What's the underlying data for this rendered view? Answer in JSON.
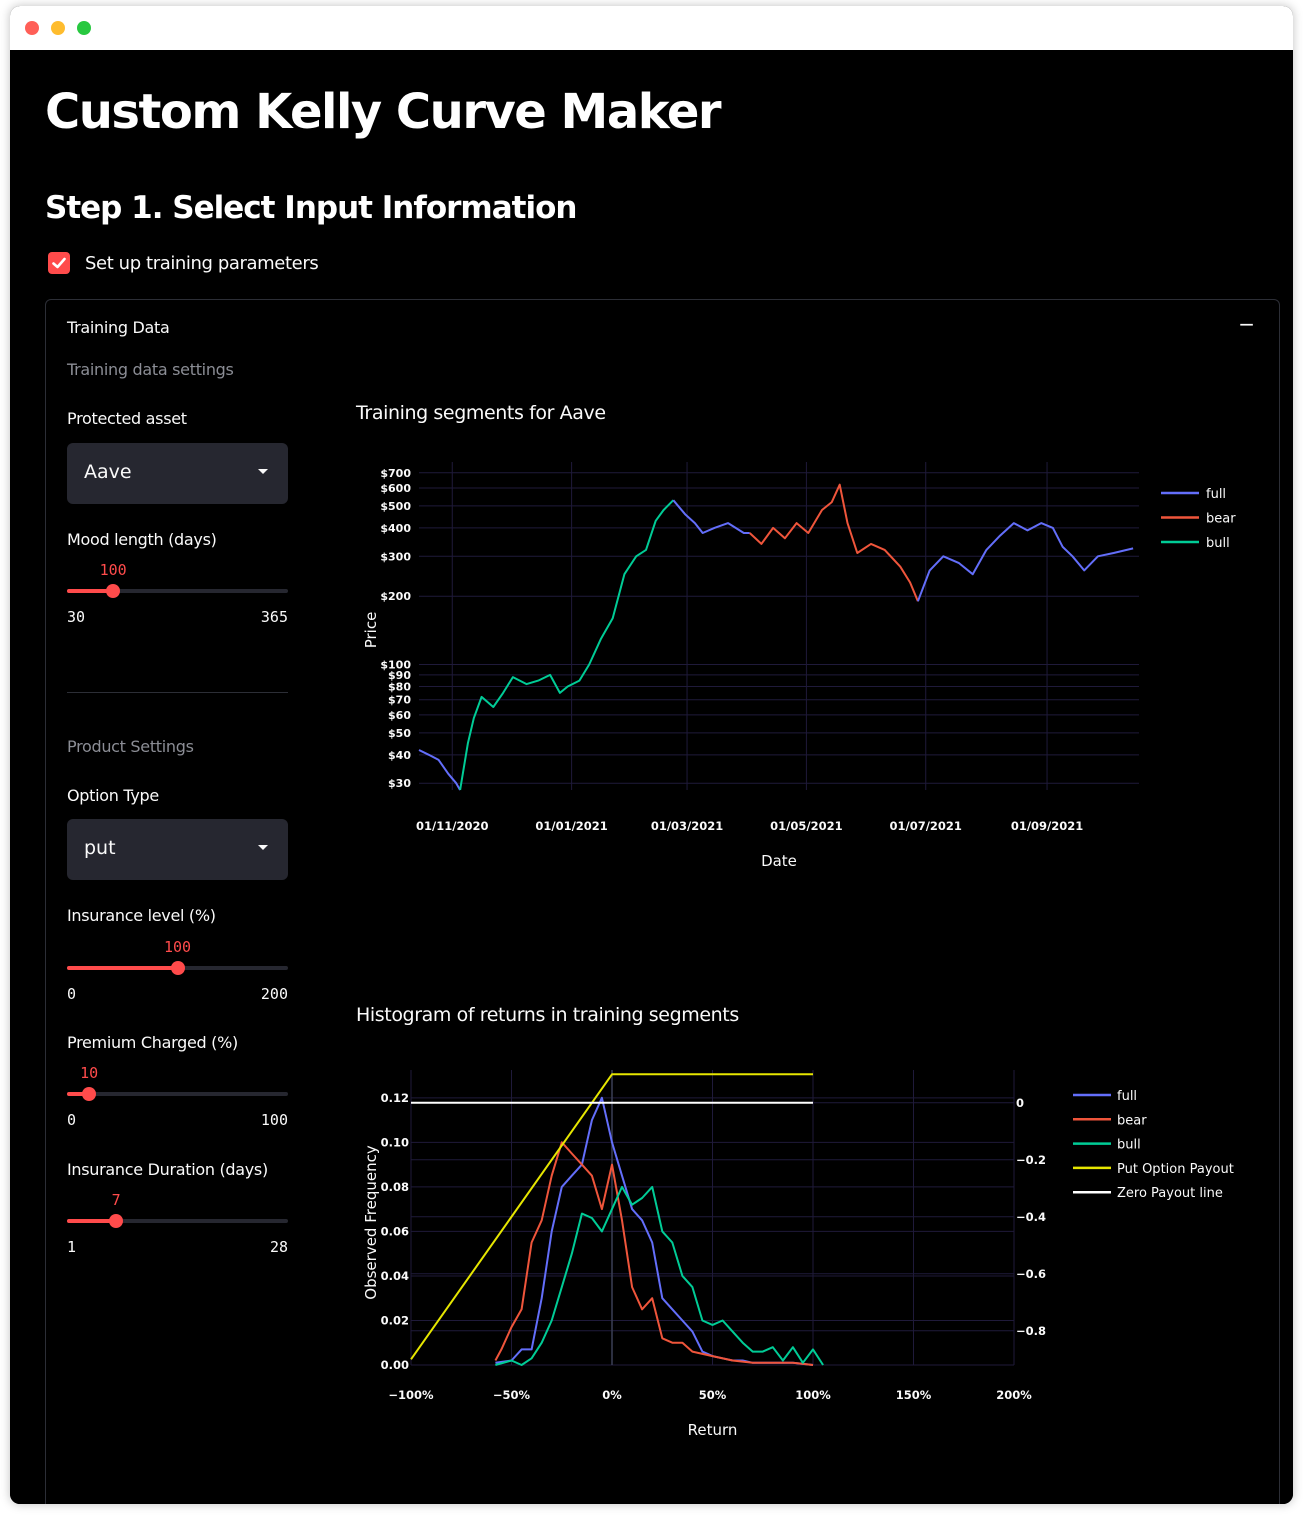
{
  "page": {
    "title": "Custom Kelly Curve Maker",
    "step_heading": "Step 1. Select Input Information",
    "checkbox_label": "Set up training parameters",
    "checkbox_checked": true
  },
  "expander": {
    "title": "Training Data",
    "collapse_icon": "minus-icon"
  },
  "sidebar": {
    "training_header": "Training data settings",
    "protected_asset_label": "Protected asset",
    "protected_asset_value": "Aave",
    "mood_length": {
      "label": "Mood length (days)",
      "value": 100,
      "min": 30,
      "max": 365,
      "value_text": "100",
      "min_text": "30",
      "max_text": "365"
    },
    "product_header": "Product Settings",
    "option_type_label": "Option Type",
    "option_type_value": "put",
    "insurance_level": {
      "label": "Insurance level (%)",
      "value": 100,
      "min": 0,
      "max": 200,
      "value_text": "100",
      "min_text": "0",
      "max_text": "200"
    },
    "premium": {
      "label": "Premium Charged (%)",
      "value": 10,
      "min": 0,
      "max": 100,
      "value_text": "10",
      "min_text": "0",
      "max_text": "100"
    },
    "duration": {
      "label": "Insurance Duration (days)",
      "value": 7,
      "min": 1,
      "max": 28,
      "value_text": "7",
      "min_text": "1",
      "max_text": "28"
    }
  },
  "colors": {
    "full": "#636efa",
    "bear": "#ef553b",
    "bull": "#00cc96",
    "payout": "#e6e600",
    "zero": "#ffffff",
    "accent": "#ff4b4b"
  },
  "chart_data": [
    {
      "type": "line",
      "title": "Training segments for Aave",
      "xlabel": "Date",
      "ylabel": "Price",
      "y_scale": "log",
      "y_ticks": [
        "$30",
        "$40",
        "$50",
        "$60",
        "$70",
        "$80",
        "$90",
        "$100",
        "$200",
        "$300",
        "$400",
        "$500",
        "$600",
        "$700"
      ],
      "x_ticks": [
        "01/11/2020",
        "01/01/2021",
        "01/03/2021",
        "01/05/2021",
        "01/07/2021",
        "01/09/2021"
      ],
      "legend": "top-right",
      "series": [
        {
          "name": "full",
          "points": [
            [
              "2020-10-15",
              42
            ],
            [
              "2020-10-20",
              40
            ],
            [
              "2020-10-25",
              38
            ],
            [
              "2020-10-30",
              33
            ],
            [
              "2020-11-03",
              30
            ],
            [
              "2020-11-05",
              28
            ]
          ]
        },
        {
          "name": "bull",
          "points": [
            [
              "2020-11-05",
              28
            ],
            [
              "2020-11-09",
              45
            ],
            [
              "2020-11-12",
              58
            ],
            [
              "2020-11-16",
              72
            ],
            [
              "2020-11-22",
              65
            ],
            [
              "2020-11-27",
              75
            ],
            [
              "2020-12-02",
              88
            ],
            [
              "2020-12-09",
              82
            ],
            [
              "2020-12-15",
              85
            ],
            [
              "2020-12-21",
              90
            ],
            [
              "2020-12-26",
              75
            ],
            [
              "2020-12-30",
              80
            ],
            [
              "2021-01-05",
              85
            ],
            [
              "2021-01-10",
              100
            ],
            [
              "2021-01-16",
              130
            ],
            [
              "2021-01-22",
              160
            ],
            [
              "2021-01-28",
              250
            ],
            [
              "2021-02-03",
              300
            ],
            [
              "2021-02-08",
              320
            ],
            [
              "2021-02-13",
              430
            ],
            [
              "2021-02-17",
              480
            ],
            [
              "2021-02-22",
              530
            ]
          ]
        },
        {
          "name": "full",
          "points": [
            [
              "2021-02-22",
              530
            ],
            [
              "2021-02-28",
              460
            ],
            [
              "2021-03-05",
              420
            ],
            [
              "2021-03-09",
              380
            ],
            [
              "2021-03-15",
              400
            ],
            [
              "2021-03-22",
              420
            ],
            [
              "2021-03-30",
              380
            ],
            [
              "2021-04-02",
              380
            ]
          ]
        },
        {
          "name": "bear",
          "points": [
            [
              "2021-04-02",
              380
            ],
            [
              "2021-04-08",
              340
            ],
            [
              "2021-04-14",
              400
            ],
            [
              "2021-04-20",
              360
            ],
            [
              "2021-04-26",
              420
            ],
            [
              "2021-05-02",
              380
            ],
            [
              "2021-05-09",
              480
            ],
            [
              "2021-05-14",
              520
            ],
            [
              "2021-05-18",
              620
            ],
            [
              "2021-05-22",
              420
            ],
            [
              "2021-05-27",
              310
            ],
            [
              "2021-06-03",
              340
            ],
            [
              "2021-06-10",
              320
            ],
            [
              "2021-06-18",
              270
            ],
            [
              "2021-06-23",
              230
            ],
            [
              "2021-06-27",
              190
            ]
          ]
        },
        {
          "name": "full",
          "points": [
            [
              "2021-06-27",
              190
            ],
            [
              "2021-07-03",
              260
            ],
            [
              "2021-07-10",
              300
            ],
            [
              "2021-07-18",
              280
            ],
            [
              "2021-07-25",
              250
            ],
            [
              "2021-08-01",
              320
            ],
            [
              "2021-08-08",
              370
            ],
            [
              "2021-08-15",
              420
            ],
            [
              "2021-08-22",
              390
            ],
            [
              "2021-08-29",
              420
            ],
            [
              "2021-09-04",
              400
            ],
            [
              "2021-09-09",
              330
            ],
            [
              "2021-09-14",
              300
            ],
            [
              "2021-09-20",
              260
            ],
            [
              "2021-09-27",
              300
            ],
            [
              "2021-10-05",
              310
            ],
            [
              "2021-10-15",
              325
            ]
          ]
        }
      ]
    },
    {
      "type": "line",
      "title": "Histogram of returns in training segments",
      "xlabel": "Return",
      "ylabel": "Observed Frequency",
      "x_ticks": [
        "−100%",
        "−50%",
        "0%",
        "50%",
        "100%",
        "150%",
        "200%"
      ],
      "y_ticks": [
        "0.00",
        "0.02",
        "0.04",
        "0.06",
        "0.08",
        "0.10",
        "0.12"
      ],
      "y2_ticks": [
        "−0.8",
        "−0.6",
        "−0.4",
        "−0.2",
        "0"
      ],
      "ylim": [
        0,
        0.128
      ],
      "y2lim": [
        -0.92,
        0.08
      ],
      "legend": "top-right",
      "series": [
        {
          "name": "full",
          "x": [
            -58,
            -50,
            -45,
            -40,
            -35,
            -30,
            -25,
            -20,
            -15,
            -10,
            -5,
            0,
            5,
            10,
            15,
            20,
            25,
            30,
            35,
            40,
            45,
            50,
            55,
            60,
            65,
            70,
            80,
            90,
            100
          ],
          "y": [
            0.001,
            0.002,
            0.007,
            0.007,
            0.03,
            0.06,
            0.08,
            0.085,
            0.09,
            0.11,
            0.12,
            0.1,
            0.085,
            0.07,
            0.065,
            0.055,
            0.03,
            0.025,
            0.02,
            0.015,
            0.006,
            0.004,
            0.003,
            0.002,
            0.002,
            0.001,
            0.001,
            0.001,
            0
          ]
        },
        {
          "name": "bear",
          "x": [
            -58,
            -55,
            -50,
            -45,
            -40,
            -35,
            -30,
            -25,
            -20,
            -15,
            -10,
            -5,
            0,
            5,
            10,
            15,
            20,
            25,
            30,
            35,
            40,
            50,
            60,
            70,
            80,
            90,
            100
          ],
          "y": [
            0.002,
            0.007,
            0.017,
            0.025,
            0.055,
            0.065,
            0.085,
            0.1,
            0.095,
            0.09,
            0.085,
            0.07,
            0.09,
            0.065,
            0.035,
            0.025,
            0.03,
            0.012,
            0.01,
            0.01,
            0.006,
            0.004,
            0.002,
            0.001,
            0.001,
            0.001,
            0
          ]
        },
        {
          "name": "bull",
          "x": [
            -58,
            -50,
            -45,
            -40,
            -35,
            -30,
            -25,
            -20,
            -15,
            -10,
            -5,
            0,
            5,
            10,
            15,
            20,
            25,
            30,
            35,
            40,
            45,
            50,
            55,
            60,
            65,
            70,
            75,
            80,
            85,
            90,
            95,
            100,
            105
          ],
          "y": [
            0,
            0.002,
            0,
            0.003,
            0.01,
            0.02,
            0.035,
            0.05,
            0.068,
            0.066,
            0.06,
            0.07,
            0.08,
            0.072,
            0.075,
            0.08,
            0.06,
            0.055,
            0.04,
            0.035,
            0.02,
            0.018,
            0.02,
            0.015,
            0.01,
            0.006,
            0.006,
            0.008,
            0.002,
            0.008,
            0.001,
            0.007,
            0
          ]
        },
        {
          "name": "Put Option Payout",
          "axis": "y2",
          "x": [
            -100,
            0,
            100
          ],
          "y": [
            -0.9,
            0.1,
            0.1
          ]
        },
        {
          "name": "Zero Payout line",
          "axis": "y2",
          "x": [
            -100,
            100
          ],
          "y": [
            0,
            0
          ]
        }
      ]
    }
  ]
}
